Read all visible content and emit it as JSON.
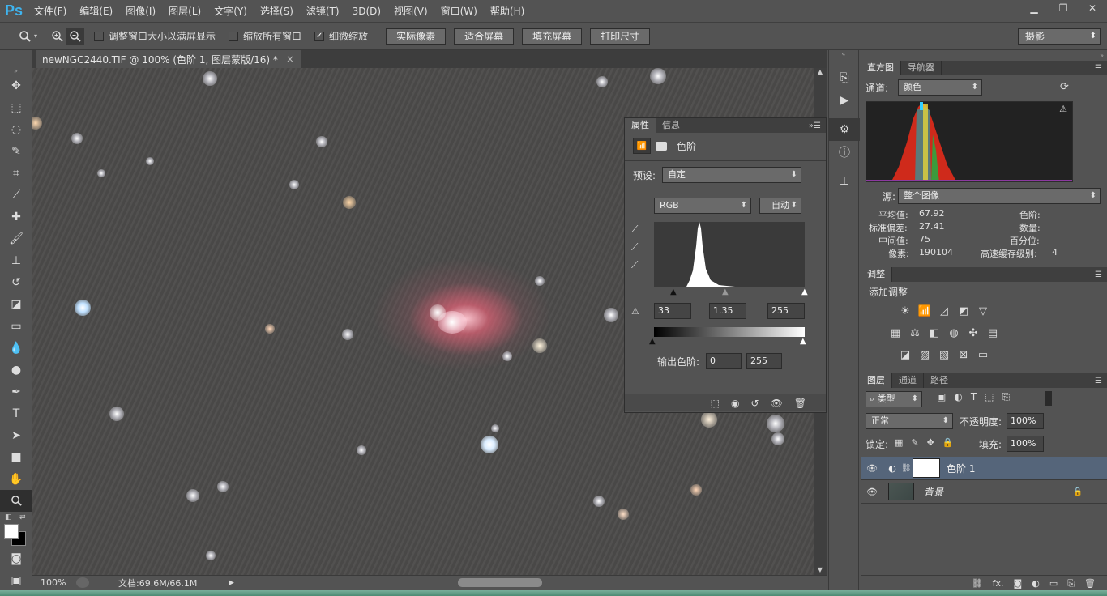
{
  "app": {
    "logo": "Ps",
    "menus": [
      "文件(F)",
      "编辑(E)",
      "图像(I)",
      "图层(L)",
      "文字(Y)",
      "选择(S)",
      "滤镜(T)",
      "3D(D)",
      "视图(V)",
      "窗口(W)",
      "帮助(H)"
    ],
    "win_minimize": "▁",
    "win_restore": "❐",
    "win_close": "✕"
  },
  "options": {
    "tool_icon": "zoom-icon",
    "check_resize": {
      "label": "调整窗口大小以满屏显示",
      "checked": false
    },
    "check_all": {
      "label": "缩放所有窗口",
      "checked": false
    },
    "check_scrubby": {
      "label": "细微缩放",
      "checked": true
    },
    "btn_actual": "实际像素",
    "btn_fit": "适合屏幕",
    "btn_fill": "填充屏幕",
    "btn_print": "打印尺寸",
    "workspace": "摄影",
    "check_mark": "✓"
  },
  "document": {
    "tab_title": "newNGC2440.TIF @ 100% (色阶 1, 图层蒙版/16) *",
    "tab_close": "×",
    "zoom": "100%",
    "doc_size": "文档:69.6M/66.1M"
  },
  "properties": {
    "tab_properties": "属性",
    "tab_info": "信息",
    "title": "色阶",
    "preset_label": "预设:",
    "preset_value": "自定",
    "channel": "RGB",
    "auto": "自动",
    "input_black": "33",
    "input_gamma": "1.35",
    "input_white": "255",
    "output_label": "输出色阶:",
    "output_black": "0",
    "output_white": "255"
  },
  "histogram": {
    "tab_hist": "直方图",
    "tab_nav": "导航器",
    "channel_label": "通道:",
    "channel_value": "颜色",
    "source_label": "源:",
    "source_value": "整个图像",
    "warning": "⚠",
    "stats": [
      {
        "label": "平均值:",
        "value": "67.92"
      },
      {
        "label": "标准偏差:",
        "value": "27.41"
      },
      {
        "label": "中间值:",
        "value": "75"
      },
      {
        "label": "像素:",
        "value": "190104"
      }
    ],
    "stats_right": [
      {
        "label": "色阶:",
        "value": ""
      },
      {
        "label": "数量:",
        "value": ""
      },
      {
        "label": "百分位:",
        "value": ""
      },
      {
        "label": "高速缓存级别:",
        "value": "4"
      }
    ]
  },
  "adjustments": {
    "tab": "调整",
    "add_label": "添加调整"
  },
  "layers": {
    "tab_layers": "图层",
    "tab_channels": "通道",
    "tab_paths": "路径",
    "filter_kind": "类型",
    "blend_mode": "正常",
    "opacity_label": "不透明度:",
    "opacity_value": "100%",
    "lock_label": "锁定:",
    "fill_label": "填充:",
    "fill_value": "100%",
    "items": [
      {
        "name": "色阶 1",
        "selected": true
      },
      {
        "name": "背景",
        "selected": false
      }
    ],
    "bottom_fx": "fx."
  },
  "colors": {
    "accent": "#3fb4ef",
    "selected_layer": "#55657a"
  }
}
